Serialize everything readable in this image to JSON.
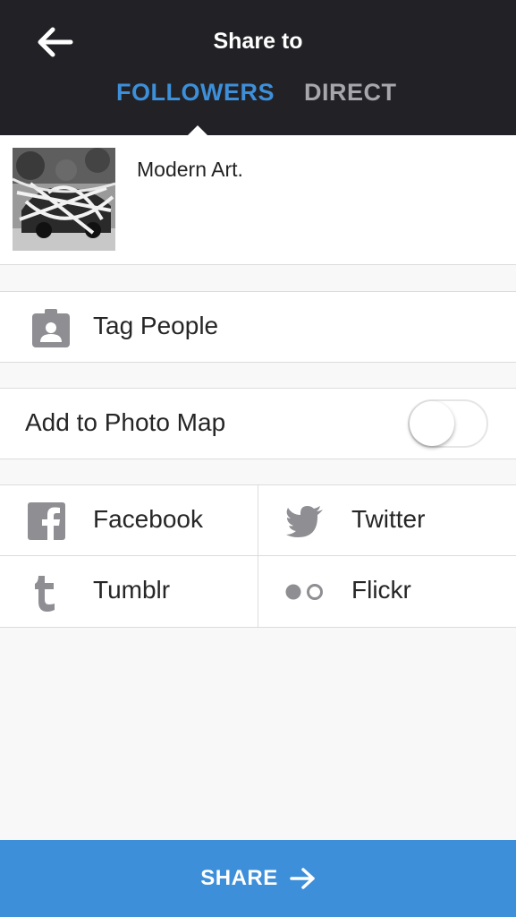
{
  "header": {
    "title": "Share to",
    "back_icon": "arrow-left-icon",
    "tabs": [
      {
        "label": "FOLLOWERS",
        "active": true,
        "color": "#3d8fd9"
      },
      {
        "label": "DIRECT",
        "active": false,
        "color": "#a7a7ab"
      }
    ],
    "background": "#222226"
  },
  "post": {
    "caption": "Modern Art."
  },
  "tag_people": {
    "label": "Tag People",
    "icon": "person-badge-icon"
  },
  "photo_map": {
    "label": "Add to Photo Map",
    "enabled": false
  },
  "social": [
    {
      "label": "Facebook",
      "icon": "facebook-icon"
    },
    {
      "label": "Twitter",
      "icon": "twitter-icon"
    },
    {
      "label": "Tumblr",
      "icon": "tumblr-icon"
    },
    {
      "label": "Flickr",
      "icon": "flickr-icon"
    }
  ],
  "footer": {
    "share_label": "SHARE",
    "icon": "arrow-right-icon",
    "background": "#3d8fd9"
  }
}
